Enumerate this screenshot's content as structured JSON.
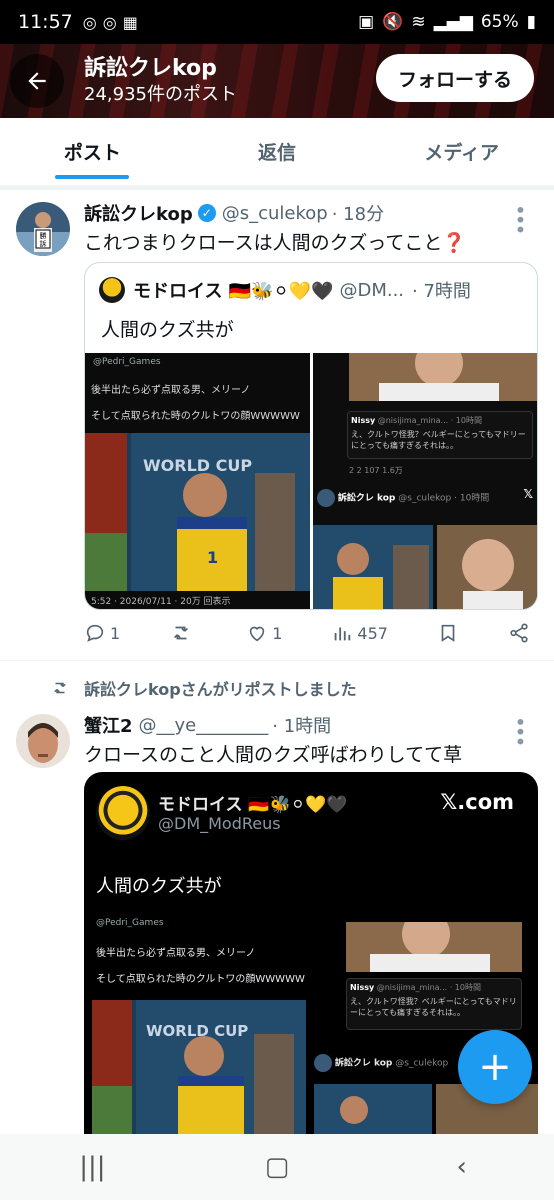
{
  "status_bar": {
    "time": "11:57",
    "battery": "65%"
  },
  "header": {
    "title": "訴訟クレkop",
    "subtitle": "24,935件のポスト",
    "follow_label": "フォローする"
  },
  "tabs": [
    {
      "label": "ポスト",
      "active": true
    },
    {
      "label": "返信",
      "active": false
    },
    {
      "label": "メディア",
      "active": false
    }
  ],
  "tweet1": {
    "name": "訴訟クレkop",
    "handle": "@s_culekop",
    "time": "· 18分",
    "text": "これつまりクロースは人間のクズってこと❓",
    "quote": {
      "name": "モドロイス 🇩🇪🐝⚪💛🖤",
      "handle": "@DM...",
      "time": "· 7時間",
      "text": "人間のクズ共が",
      "media_left": {
        "source": "@Pedri_Games",
        "line1": "後半出たら必ず点取る男、メリーノ",
        "line2": "そして点取られた時のクルトワの顔WWWWW",
        "footer": "5:52 · 2026/07/11 · 20万 回表示"
      },
      "media_right": {
        "reply_user": "Nissy",
        "reply_handle": "@nisijima_mina... · 10時間",
        "reply_text": "え、クルトワ怪我？ベルギーにとってもマドリーにとっても痛すぎるそれは。。",
        "stats": "2   2   107   1.6万",
        "embed_user": "訴訟クレ kop",
        "embed_handle": "@s_culekop · 10時間"
      }
    },
    "actions": {
      "replies": "1",
      "reposts": "",
      "likes": "1",
      "views": "457"
    }
  },
  "repost_notice": "訴訟クレkopさんがリポストしました",
  "tweet2": {
    "name": "蟹江2",
    "handle": "@__ye________",
    "time": "· 1時間",
    "text": "クロースのこと人間のクズ呼ばわりしてて草",
    "card": {
      "name": "モドロイス 🇩🇪🐝⚪💛🖤",
      "handle": "@DM_ModReus",
      "site": "𝕏.com",
      "text": "人間のクズ共が",
      "media_left": {
        "source": "@Pedri_Games",
        "line1": "後半出たら必ず点取る男、メリーノ",
        "line2": "そして点取られた時のクルトワの顔WWWWW"
      },
      "media_right": {
        "reply_user": "Nissy",
        "reply_handle": "@nisijima_mina... · 10時間",
        "reply_text": "え、クルトワ怪我？ベルギーにとってもマドリーにとっても痛すぎるそれは。。",
        "embed_user": "訴訟クレ kop",
        "embed_handle": "@s_culekop"
      }
    }
  },
  "colors": {
    "accent": "#1d9bf0",
    "text": "#0f1419",
    "muted": "#536471"
  }
}
